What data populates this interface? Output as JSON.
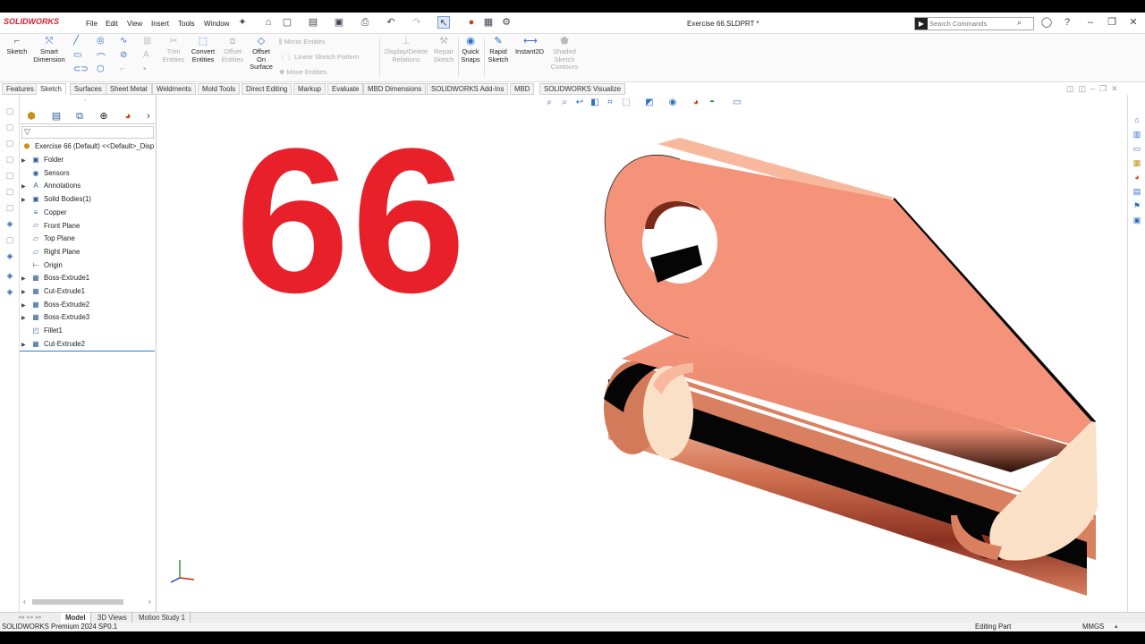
{
  "app": {
    "logo": "SOLIDWORKS",
    "document_title": "Exercise 66.SLDPRT *"
  },
  "menu": [
    "File",
    "Edit",
    "View",
    "Insert",
    "Tools",
    "Window"
  ],
  "search": {
    "placeholder": "Search Commands",
    "value": ""
  },
  "command_manager": {
    "sketch": "Sketch",
    "smart_dimension": [
      "Smart",
      "Dimension"
    ],
    "trim_entities": [
      "Trim",
      "Entities"
    ],
    "convert_entities": [
      "Convert",
      "Entities"
    ],
    "offset_entities": [
      "Offset",
      "Entities"
    ],
    "offset_on_surface": [
      "Offset",
      "On",
      "Surface"
    ],
    "mirror_entities": "Mirror Entities",
    "linear_sketch_pattern": "Linear Sketch Pattern",
    "move_entities": "Move Entities",
    "display_delete_relations": [
      "Display/Delete",
      "Relations"
    ],
    "repair_sketch": [
      "Repair",
      "Sketch"
    ],
    "quick_snaps": [
      "Quick",
      "Snaps"
    ],
    "rapid_sketch": [
      "Rapid",
      "Sketch"
    ],
    "instant2d": "Instant2D",
    "shaded_sketch_contours": [
      "Shaded",
      "Sketch",
      "Contours"
    ]
  },
  "tabs": [
    "Features",
    "Sketch",
    "Surfaces",
    "Sheet Metal",
    "Weldments",
    "Mold Tools",
    "Direct Editing",
    "Markup",
    "Evaluate",
    "MBD Dimensions",
    "SOLIDWORKS Add-Ins",
    "MBD",
    "SOLIDWORKS Visualize"
  ],
  "active_tab": "Sketch",
  "tree": {
    "root": "Exercise 66 (Default) <<Default>_Disp",
    "items": [
      {
        "label": "Folder",
        "expandable": true
      },
      {
        "label": "Sensors",
        "expandable": false
      },
      {
        "label": "Annotations",
        "expandable": true
      },
      {
        "label": "Solid Bodies(1)",
        "expandable": true
      },
      {
        "label": "Copper",
        "expandable": false
      },
      {
        "label": "Front Plane",
        "expandable": false
      },
      {
        "label": "Top Plane",
        "expandable": false
      },
      {
        "label": "Right Plane",
        "expandable": false
      },
      {
        "label": "Origin",
        "expandable": false
      },
      {
        "label": "Boss-Extrude1",
        "expandable": true
      },
      {
        "label": "Cut-Extrude1",
        "expandable": true
      },
      {
        "label": "Boss-Extrude2",
        "expandable": true
      },
      {
        "label": "Boss-Extrude3",
        "expandable": true
      },
      {
        "label": "Fillet1",
        "expandable": false
      },
      {
        "label": "Cut-Extrude2",
        "expandable": true
      }
    ]
  },
  "viewport": {
    "overlay_number": "66",
    "overlay_color": "#e8202a",
    "part_color": "#f4937a"
  },
  "bottom_tabs": [
    "Model",
    "3D Views",
    "Motion Study 1"
  ],
  "active_bottom_tab": "Model",
  "status": {
    "version": "SOLIDWORKS Premium 2024 SP0.1",
    "mode": "Editing Part",
    "units": "MMGS"
  }
}
